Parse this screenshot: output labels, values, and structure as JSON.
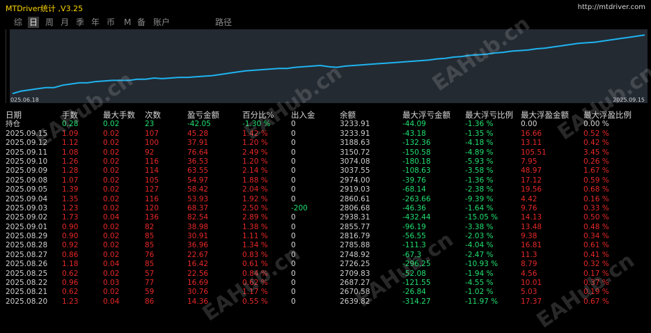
{
  "app": {
    "title": "MTDriver统计 ,V3.25",
    "url": "http://mtdriver.com"
  },
  "tabs": [
    {
      "label": "综",
      "active": false
    },
    {
      "label": "日",
      "active": true
    },
    {
      "label": "周",
      "active": false
    },
    {
      "label": "月",
      "active": false
    },
    {
      "label": "季",
      "active": false
    },
    {
      "label": "年",
      "active": false
    },
    {
      "label": "币",
      "active": false
    },
    {
      "label": "M",
      "active": false
    },
    {
      "label": "备",
      "active": false
    },
    {
      "label": "账户",
      "active": false
    },
    {
      "label": "路径",
      "active": false
    }
  ],
  "chart_data": {
    "type": "line",
    "x_start_label": "2025.06.18",
    "x_end_label": "2025.09.15",
    "series": [
      {
        "color": "#1eb4f0",
        "values": [
          0.02,
          0.06,
          0.08,
          0.1,
          0.12,
          0.12,
          0.16,
          0.18,
          0.2,
          0.2,
          0.22,
          0.23,
          0.24,
          0.24,
          0.24,
          0.26,
          0.26,
          0.28,
          0.27,
          0.28,
          0.29,
          0.29,
          0.3,
          0.31,
          0.32,
          0.34,
          0.36,
          0.38,
          0.4,
          0.41,
          0.42,
          0.43,
          0.44,
          0.44,
          0.46,
          0.47,
          0.48,
          0.49,
          0.47,
          0.46,
          0.48,
          0.49,
          0.5,
          0.51,
          0.52,
          0.53,
          0.54,
          0.55,
          0.56,
          0.57,
          0.58,
          0.6,
          0.61,
          0.63,
          0.64,
          0.66,
          0.67,
          0.68,
          0.7,
          0.71,
          0.73,
          0.74,
          0.75,
          0.77,
          0.78,
          0.8,
          0.82,
          0.84,
          0.86,
          0.87,
          0.88,
          0.9,
          0.92,
          0.94,
          0.96,
          0.98,
          1.0
        ]
      }
    ],
    "ylim": [
      0,
      1.05
    ]
  },
  "table": {
    "headers": [
      "日期",
      "手数",
      "最大手数",
      "次数",
      "盈亏金额",
      "百分比%",
      "出入金",
      "余额",
      "最大浮亏金额",
      "最大浮亏比例",
      "最大浮盈金额",
      "最大浮盈比例"
    ],
    "rows": [
      [
        "持仓",
        "0.28",
        "0.02",
        "23",
        "-42.05",
        "-1.30 %",
        "0",
        "3233.91",
        "-44.09",
        "-1.36 %",
        "0.00",
        "0.00 %"
      ],
      [
        "2025.09.15",
        "1.09",
        "0.02",
        "107",
        "45.28",
        "1.42 %",
        "0",
        "3233.91",
        "-43.18",
        "-1.35 %",
        "16.66",
        "0.52 %"
      ],
      [
        "2025.09.12",
        "1.12",
        "0.02",
        "100",
        "37.91",
        "1.20 %",
        "0",
        "3188.63",
        "-132.36",
        "-4.18 %",
        "13.11",
        "0.42 %"
      ],
      [
        "2025.09.11",
        "1.08",
        "0.02",
        "92",
        "76.64",
        "2.49 %",
        "0",
        "3150.72",
        "-150.58",
        "-4.89 %",
        "105.51",
        "3.45 %"
      ],
      [
        "2025.09.10",
        "1.26",
        "0.02",
        "116",
        "36.53",
        "1.20 %",
        "0",
        "3074.08",
        "-180.18",
        "-5.93 %",
        "7.95",
        "0.26 %"
      ],
      [
        "2025.09.09",
        "1.28",
        "0.02",
        "114",
        "63.55",
        "2.14 %",
        "0",
        "3037.55",
        "-108.63",
        "-3.58 %",
        "48.97",
        "1.67 %"
      ],
      [
        "2025.09.08",
        "1.07",
        "0.02",
        "105",
        "54.97",
        "1.88 %",
        "0",
        "2974.00",
        "-39.76",
        "-1.36 %",
        "17.12",
        "0.59 %"
      ],
      [
        "2025.09.05",
        "1.39",
        "0.02",
        "127",
        "58.42",
        "2.04 %",
        "0",
        "2919.03",
        "-68.14",
        "-2.38 %",
        "19.56",
        "0.68 %"
      ],
      [
        "2025.09.04",
        "1.35",
        "0.02",
        "116",
        "53.93",
        "1.92 %",
        "0",
        "2860.61",
        "-263.66",
        "-9.39 %",
        "4.42",
        "0.16 %"
      ],
      [
        "2025.09.03",
        "1.23",
        "0.02",
        "120",
        "68.37",
        "2.50 %",
        "-200",
        "2806.68",
        "-46.36",
        "-1.64 %",
        "9.76",
        "0.33 %"
      ],
      [
        "2025.09.02",
        "1.73",
        "0.04",
        "136",
        "82.54",
        "2.89 %",
        "0",
        "2938.31",
        "-432.44",
        "-15.05 %",
        "14.13",
        "0.50 %"
      ],
      [
        "2025.09.01",
        "0.90",
        "0.02",
        "82",
        "38.98",
        "1.38 %",
        "0",
        "2855.77",
        "-96.19",
        "-3.38 %",
        "13.48",
        "0.48 %"
      ],
      [
        "2025.08.29",
        "0.90",
        "0.02",
        "85",
        "30.91",
        "1.11 %",
        "0",
        "2816.79",
        "-56.55",
        "-2.03 %",
        "9.38",
        "0.34 %"
      ],
      [
        "2025.08.28",
        "0.92",
        "0.02",
        "85",
        "36.96",
        "1.34 %",
        "0",
        "2785.88",
        "-111.3",
        "-4.04 %",
        "16.81",
        "0.61 %"
      ],
      [
        "2025.08.27",
        "0.86",
        "0.02",
        "76",
        "22.67",
        "0.83 %",
        "0",
        "2748.92",
        "-67.3",
        "-2.47 %",
        "11.3",
        "0.41 %"
      ],
      [
        "2025.08.26",
        "1.18",
        "0.04",
        "85",
        "16.42",
        "0.61 %",
        "0",
        "2726.25",
        "-296.25",
        "-10.93 %",
        "8.79",
        "0.32 %"
      ],
      [
        "2025.08.25",
        "0.62",
        "0.02",
        "57",
        "22.56",
        "0.84 %",
        "0",
        "2709.83",
        "-52.08",
        "-1.94 %",
        "4.56",
        "0.17 %"
      ],
      [
        "2025.08.22",
        "0.96",
        "0.03",
        "77",
        "16.69",
        "0.62 %",
        "0",
        "2687.27",
        "-121.55",
        "-4.55 %",
        "10.01",
        "0.37 %"
      ],
      [
        "2025.08.21",
        "0.62",
        "0.02",
        "59",
        "30.76",
        "1.17 %",
        "0",
        "2670.58",
        "-26.84",
        "-1.02 %",
        "5.03",
        "0.19 %"
      ],
      [
        "2025.08.20",
        "1.23",
        "0.04",
        "86",
        "14.36",
        "0.55 %",
        "0",
        "2639.82",
        "-314.27",
        "-11.97 %",
        "17.37",
        "0.67 %"
      ]
    ]
  },
  "watermark": "EAHub.cn"
}
